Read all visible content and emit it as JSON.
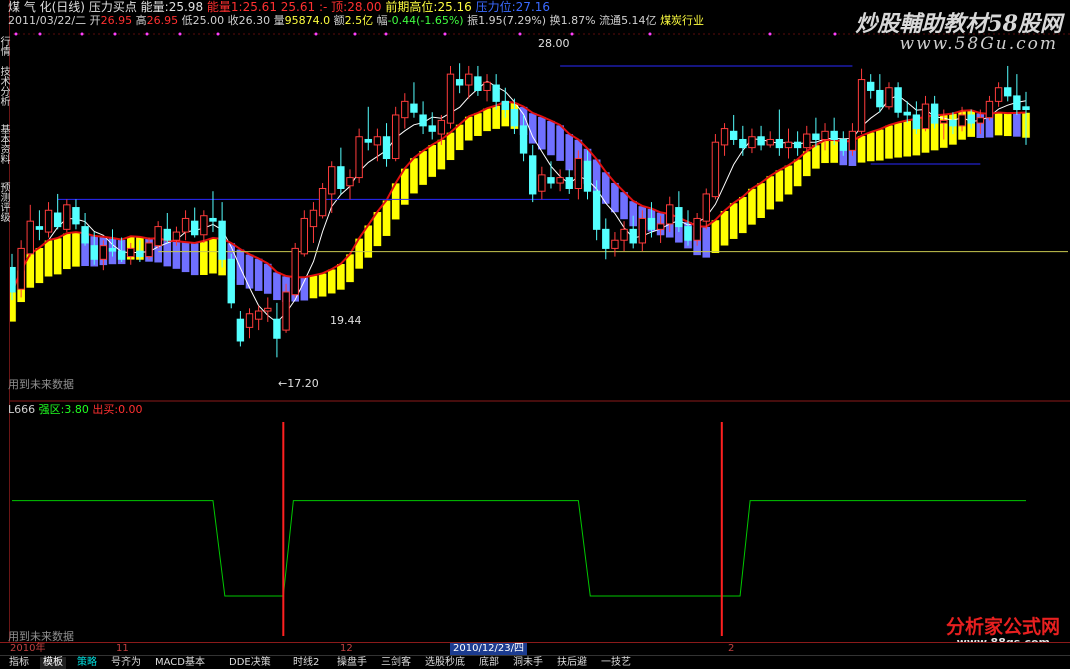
{
  "header": {
    "stock_name": "煤 气 化(日线)",
    "formula_name": "压力买点",
    "volume_label": "能量:",
    "volume_value": "25.98",
    "support_label": "能量1:",
    "support_value": "25.61",
    "support2_value": "25.61 :-",
    "high_label": "顶:",
    "high_value": "28.00",
    "prev_high_label": "前期高位:",
    "prev_high_value": "25.16",
    "blurred_label": "压力位:",
    "blurred_value": "27.16"
  },
  "info": {
    "date": "2011/03/22/二",
    "open_label": "开",
    "open": "26.95",
    "high_label": "高",
    "high": "26.95",
    "low_label": "低",
    "low": "25.00",
    "close_label": "收",
    "close": "26.30",
    "vol_label": "量",
    "vol": "95874.0",
    "amount_label": "额",
    "amount": "2.5亿",
    "change_label": "幅",
    "change": "-0.44(-1.65%)",
    "amp_label": "振",
    "amp": "1.95(7.29%)",
    "turnover_label": "换",
    "turnover": "1.87%",
    "float_label": "流通",
    "float": "5.14亿",
    "industry": "煤炭行业"
  },
  "left_tabs": [
    "行情",
    "技术分析",
    "基本资料",
    "预测评级"
  ],
  "annotations": {
    "peak": "28.00",
    "trough1": "←17.20",
    "trough2": "19.44",
    "future_note1": "用到未来数据",
    "future_note2": "用到未来数据"
  },
  "indicator": {
    "name": "L666",
    "strong_label": "强区:",
    "strong_value": "3.80",
    "buy_label": "出买:",
    "buy_value": "0.00"
  },
  "date_axis": {
    "labels": [
      "2010年",
      "11",
      "12",
      "2010/12/23/四",
      "2"
    ],
    "selected_index": 3
  },
  "tabs": [
    "指标",
    "模板",
    "策略",
    "号齐为",
    "MACD基本",
    "DDE决策",
    "时线2",
    "操盘手",
    "三剑客",
    "选股秒底",
    "底部",
    "洞未手",
    "扶后避",
    "一技艺"
  ],
  "active_tab": 1,
  "selected_tab": 2,
  "watermarks": {
    "top": "炒股輔助教材58股网",
    "top_sub": "www.58Gu.com",
    "bottom": "分析家公式网",
    "bottom_sub": "www.88gs.com"
  },
  "colors": {
    "up": "#ff3c3c",
    "down": "#54ffff",
    "ribbon_up": "#ffff00",
    "ribbon_down": "#7070ff",
    "ma_short": "#ffffff",
    "ma_long": "#e01010",
    "resist": "#2a2aff",
    "indicator": "#00c800",
    "signal": "#ff2020"
  },
  "chart_data": {
    "type": "candlestick",
    "ylim": [
      16.0,
      29.0
    ],
    "candles": [
      {
        "o": 20.5,
        "h": 21.0,
        "l": 19.3,
        "c": 19.6
      },
      {
        "o": 19.7,
        "h": 21.5,
        "l": 19.4,
        "c": 21.2
      },
      {
        "o": 21.0,
        "h": 22.8,
        "l": 20.9,
        "c": 22.2
      },
      {
        "o": 22.0,
        "h": 22.6,
        "l": 21.5,
        "c": 21.9
      },
      {
        "o": 21.8,
        "h": 22.9,
        "l": 21.6,
        "c": 22.6
      },
      {
        "o": 22.5,
        "h": 23.2,
        "l": 21.9,
        "c": 22.0
      },
      {
        "o": 21.9,
        "h": 23.0,
        "l": 21.8,
        "c": 22.8
      },
      {
        "o": 22.7,
        "h": 23.0,
        "l": 21.9,
        "c": 22.1
      },
      {
        "o": 22.0,
        "h": 22.5,
        "l": 21.3,
        "c": 21.4
      },
      {
        "o": 21.3,
        "h": 21.8,
        "l": 20.6,
        "c": 20.8
      },
      {
        "o": 20.8,
        "h": 21.5,
        "l": 20.4,
        "c": 21.3
      },
      {
        "o": 21.2,
        "h": 21.9,
        "l": 20.9,
        "c": 21.1
      },
      {
        "o": 21.1,
        "h": 21.6,
        "l": 20.7,
        "c": 20.8
      },
      {
        "o": 20.9,
        "h": 21.4,
        "l": 20.6,
        "c": 21.2
      },
      {
        "o": 21.1,
        "h": 21.5,
        "l": 20.7,
        "c": 20.9
      },
      {
        "o": 20.9,
        "h": 21.6,
        "l": 20.8,
        "c": 21.4
      },
      {
        "o": 21.3,
        "h": 22.2,
        "l": 21.2,
        "c": 22.0
      },
      {
        "o": 21.9,
        "h": 22.5,
        "l": 21.4,
        "c": 21.5
      },
      {
        "o": 21.5,
        "h": 22.0,
        "l": 21.3,
        "c": 21.8
      },
      {
        "o": 21.8,
        "h": 22.6,
        "l": 21.5,
        "c": 22.3
      },
      {
        "o": 22.2,
        "h": 22.7,
        "l": 21.6,
        "c": 21.7
      },
      {
        "o": 21.7,
        "h": 22.6,
        "l": 21.4,
        "c": 22.4
      },
      {
        "o": 22.3,
        "h": 23.3,
        "l": 21.8,
        "c": 22.2
      },
      {
        "o": 22.2,
        "h": 22.9,
        "l": 20.5,
        "c": 20.8
      },
      {
        "o": 20.8,
        "h": 21.0,
        "l": 19.0,
        "c": 19.2
      },
      {
        "o": 18.6,
        "h": 18.9,
        "l": 17.6,
        "c": 17.8
      },
      {
        "o": 18.3,
        "h": 19.0,
        "l": 17.9,
        "c": 18.8
      },
      {
        "o": 18.6,
        "h": 19.1,
        "l": 18.2,
        "c": 18.9
      },
      {
        "o": 18.9,
        "h": 19.4,
        "l": 18.5,
        "c": 19.0
      },
      {
        "o": 18.6,
        "h": 19.2,
        "l": 17.2,
        "c": 17.9
      },
      {
        "o": 18.2,
        "h": 19.9,
        "l": 18.1,
        "c": 19.6
      },
      {
        "o": 19.5,
        "h": 21.4,
        "l": 19.4,
        "c": 21.2
      },
      {
        "o": 21.0,
        "h": 22.6,
        "l": 20.9,
        "c": 22.3
      },
      {
        "o": 22.0,
        "h": 22.9,
        "l": 21.4,
        "c": 22.6
      },
      {
        "o": 22.4,
        "h": 23.6,
        "l": 22.3,
        "c": 23.4
      },
      {
        "o": 23.2,
        "h": 24.4,
        "l": 22.5,
        "c": 24.2
      },
      {
        "o": 24.2,
        "h": 24.9,
        "l": 23.2,
        "c": 23.4
      },
      {
        "o": 23.5,
        "h": 24.1,
        "l": 23.0,
        "c": 23.8
      },
      {
        "o": 23.8,
        "h": 25.6,
        "l": 23.6,
        "c": 25.3
      },
      {
        "o": 25.2,
        "h": 26.4,
        "l": 24.8,
        "c": 25.1
      },
      {
        "o": 25.0,
        "h": 25.6,
        "l": 24.4,
        "c": 25.3
      },
      {
        "o": 25.3,
        "h": 25.8,
        "l": 24.2,
        "c": 24.5
      },
      {
        "o": 24.5,
        "h": 26.4,
        "l": 24.4,
        "c": 26.1
      },
      {
        "o": 26.0,
        "h": 26.9,
        "l": 25.6,
        "c": 26.6
      },
      {
        "o": 26.5,
        "h": 27.3,
        "l": 26.0,
        "c": 26.2
      },
      {
        "o": 26.1,
        "h": 26.6,
        "l": 25.4,
        "c": 25.7
      },
      {
        "o": 25.7,
        "h": 26.2,
        "l": 25.2,
        "c": 25.5
      },
      {
        "o": 25.4,
        "h": 26.1,
        "l": 25.0,
        "c": 25.9
      },
      {
        "o": 25.8,
        "h": 27.9,
        "l": 25.6,
        "c": 27.6
      },
      {
        "o": 27.4,
        "h": 28.0,
        "l": 26.9,
        "c": 27.2
      },
      {
        "o": 27.2,
        "h": 27.9,
        "l": 26.7,
        "c": 27.6
      },
      {
        "o": 27.5,
        "h": 27.9,
        "l": 26.8,
        "c": 27.0
      },
      {
        "o": 27.0,
        "h": 27.6,
        "l": 26.6,
        "c": 27.3
      },
      {
        "o": 27.2,
        "h": 27.6,
        "l": 26.3,
        "c": 26.6
      },
      {
        "o": 26.6,
        "h": 27.1,
        "l": 26.0,
        "c": 26.3
      },
      {
        "o": 26.3,
        "h": 26.7,
        "l": 25.4,
        "c": 25.7
      },
      {
        "o": 25.7,
        "h": 26.1,
        "l": 24.4,
        "c": 24.7
      },
      {
        "o": 24.6,
        "h": 25.0,
        "l": 22.9,
        "c": 23.2
      },
      {
        "o": 23.3,
        "h": 24.2,
        "l": 23.0,
        "c": 23.9
      },
      {
        "o": 23.8,
        "h": 24.4,
        "l": 23.4,
        "c": 23.6
      },
      {
        "o": 23.6,
        "h": 24.1,
        "l": 23.3,
        "c": 23.8
      },
      {
        "o": 23.8,
        "h": 24.1,
        "l": 23.2,
        "c": 23.4
      },
      {
        "o": 23.4,
        "h": 24.8,
        "l": 23.0,
        "c": 24.5
      },
      {
        "o": 24.4,
        "h": 24.8,
        "l": 23.0,
        "c": 23.3
      },
      {
        "o": 23.3,
        "h": 23.7,
        "l": 21.5,
        "c": 21.9
      },
      {
        "o": 21.9,
        "h": 22.3,
        "l": 20.8,
        "c": 21.2
      },
      {
        "o": 21.2,
        "h": 21.8,
        "l": 20.9,
        "c": 21.5
      },
      {
        "o": 21.5,
        "h": 22.2,
        "l": 21.1,
        "c": 21.9
      },
      {
        "o": 21.9,
        "h": 22.4,
        "l": 21.2,
        "c": 21.4
      },
      {
        "o": 21.4,
        "h": 22.6,
        "l": 21.1,
        "c": 22.3
      },
      {
        "o": 22.3,
        "h": 22.9,
        "l": 21.6,
        "c": 21.9
      },
      {
        "o": 21.9,
        "h": 22.4,
        "l": 21.4,
        "c": 22.1
      },
      {
        "o": 22.1,
        "h": 23.1,
        "l": 21.8,
        "c": 22.8
      },
      {
        "o": 22.7,
        "h": 23.3,
        "l": 21.8,
        "c": 22.0
      },
      {
        "o": 22.0,
        "h": 22.6,
        "l": 21.3,
        "c": 21.5
      },
      {
        "o": 21.5,
        "h": 22.5,
        "l": 21.3,
        "c": 22.3
      },
      {
        "o": 22.2,
        "h": 23.4,
        "l": 21.9,
        "c": 23.2
      },
      {
        "o": 23.1,
        "h": 25.4,
        "l": 23.0,
        "c": 25.1
      },
      {
        "o": 25.0,
        "h": 25.8,
        "l": 24.6,
        "c": 25.6
      },
      {
        "o": 25.5,
        "h": 26.1,
        "l": 25.0,
        "c": 25.2
      },
      {
        "o": 25.2,
        "h": 25.7,
        "l": 24.6,
        "c": 24.9
      },
      {
        "o": 24.9,
        "h": 25.6,
        "l": 24.7,
        "c": 25.3
      },
      {
        "o": 25.3,
        "h": 25.7,
        "l": 24.8,
        "c": 25.0
      },
      {
        "o": 25.0,
        "h": 25.5,
        "l": 24.9,
        "c": 25.2
      },
      {
        "o": 25.2,
        "h": 26.3,
        "l": 24.6,
        "c": 24.9
      },
      {
        "o": 24.9,
        "h": 25.6,
        "l": 24.5,
        "c": 25.1
      },
      {
        "o": 25.1,
        "h": 25.5,
        "l": 24.6,
        "c": 24.9
      },
      {
        "o": 24.9,
        "h": 25.7,
        "l": 24.7,
        "c": 25.4
      },
      {
        "o": 25.4,
        "h": 26.0,
        "l": 24.9,
        "c": 25.2
      },
      {
        "o": 25.2,
        "h": 25.8,
        "l": 24.8,
        "c": 25.5
      },
      {
        "o": 25.5,
        "h": 26.0,
        "l": 25.0,
        "c": 25.2
      },
      {
        "o": 25.2,
        "h": 25.5,
        "l": 24.6,
        "c": 24.8
      },
      {
        "o": 24.8,
        "h": 25.8,
        "l": 24.6,
        "c": 25.5
      },
      {
        "o": 25.5,
        "h": 27.8,
        "l": 25.4,
        "c": 27.4
      },
      {
        "o": 27.3,
        "h": 27.6,
        "l": 26.7,
        "c": 27.0
      },
      {
        "o": 27.0,
        "h": 27.6,
        "l": 26.2,
        "c": 26.4
      },
      {
        "o": 26.4,
        "h": 27.3,
        "l": 26.3,
        "c": 27.1
      },
      {
        "o": 27.1,
        "h": 27.3,
        "l": 26.0,
        "c": 26.2
      },
      {
        "o": 26.2,
        "h": 26.6,
        "l": 25.8,
        "c": 26.1
      },
      {
        "o": 26.1,
        "h": 26.6,
        "l": 25.4,
        "c": 25.6
      },
      {
        "o": 25.6,
        "h": 26.8,
        "l": 25.5,
        "c": 26.5
      },
      {
        "o": 26.5,
        "h": 26.8,
        "l": 25.6,
        "c": 25.8
      },
      {
        "o": 25.8,
        "h": 26.3,
        "l": 25.2,
        "c": 25.9
      },
      {
        "o": 25.9,
        "h": 26.2,
        "l": 25.4,
        "c": 25.7
      },
      {
        "o": 25.7,
        "h": 26.4,
        "l": 25.5,
        "c": 26.1
      },
      {
        "o": 26.1,
        "h": 26.3,
        "l": 25.6,
        "c": 25.8
      },
      {
        "o": 25.8,
        "h": 26.3,
        "l": 25.4,
        "c": 26.0
      },
      {
        "o": 26.0,
        "h": 26.8,
        "l": 25.9,
        "c": 26.6
      },
      {
        "o": 26.6,
        "h": 27.3,
        "l": 26.4,
        "c": 27.1
      },
      {
        "o": 27.1,
        "h": 27.9,
        "l": 26.6,
        "c": 26.8
      },
      {
        "o": 26.8,
        "h": 27.6,
        "l": 26.1,
        "c": 26.3
      },
      {
        "o": 26.4,
        "h": 26.95,
        "l": 25.0,
        "c": 26.3
      }
    ],
    "resistance_levels": [
      {
        "value": 23.0,
        "from": 5,
        "to": 61
      },
      {
        "value": 27.9,
        "from": 60,
        "to": 92
      },
      {
        "value": 24.3,
        "from": 94,
        "to": 106
      }
    ],
    "support_level": 21.08,
    "indicator": {
      "ylim": [
        0,
        6
      ],
      "high": 3.8,
      "low": 1.2,
      "low_zones": [
        [
          23,
          31
        ],
        [
          63,
          81
        ]
      ],
      "signals": [
        33,
        81
      ]
    }
  }
}
